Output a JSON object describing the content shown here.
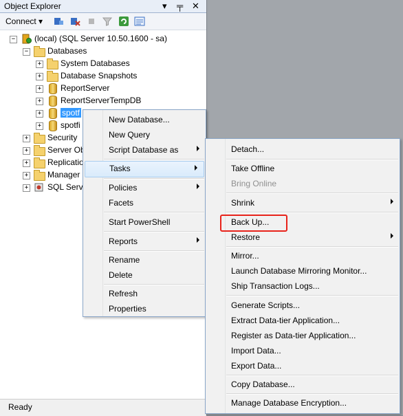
{
  "panel": {
    "title": "Object Explorer",
    "pin_glyph": "▾",
    "pushpin_glyph": "╤",
    "close_glyph": "✕",
    "connect_label": "Connect ▾"
  },
  "tree": [
    {
      "label": "(local) (SQL Server 10.50.1600 - sa)",
      "expander": "−",
      "icon": "server-icon"
    },
    {
      "label": "Databases",
      "expander": "−",
      "icon": "folder-icon"
    },
    {
      "label": "System Databases",
      "expander": "+",
      "icon": "folder-icon"
    },
    {
      "label": "Database Snapshots",
      "expander": "+",
      "icon": "folder-icon"
    },
    {
      "label": "ReportServer",
      "expander": "+",
      "icon": "database-icon"
    },
    {
      "label": "ReportServerTempDB",
      "expander": "+",
      "icon": "database-icon"
    },
    {
      "label": "spotf",
      "expander": "+",
      "icon": "database-icon"
    },
    {
      "label": "spotfi",
      "expander": "+",
      "icon": "database-icon"
    },
    {
      "label": "Security",
      "expander": "+",
      "icon": "folder-icon"
    },
    {
      "label": "Server Ob",
      "expander": "+",
      "icon": "folder-icon"
    },
    {
      "label": "Replicatio",
      "expander": "+",
      "icon": "folder-icon"
    },
    {
      "label": "Manager",
      "expander": "+",
      "icon": "folder-icon"
    },
    {
      "label": "SQL Serve",
      "expander": "+",
      "icon": "agent-icon"
    }
  ],
  "context_menu": [
    {
      "label": "New Database..."
    },
    {
      "label": "New Query"
    },
    {
      "label": "Script Database as",
      "submenu": true
    },
    {
      "label": "Tasks",
      "submenu": true,
      "highlighted": true
    },
    {
      "label": "Policies",
      "submenu": true
    },
    {
      "label": "Facets"
    },
    {
      "label": "Start PowerShell"
    },
    {
      "label": "Reports",
      "submenu": true
    },
    {
      "label": "Rename"
    },
    {
      "label": "Delete"
    },
    {
      "label": "Refresh"
    },
    {
      "label": "Properties"
    }
  ],
  "tasks_menu": [
    {
      "label": "Detach..."
    },
    {
      "label": "Take Offline"
    },
    {
      "label": "Bring Online",
      "disabled": true
    },
    {
      "label": "Shrink",
      "submenu": true
    },
    {
      "label": "Back Up...",
      "callout": true
    },
    {
      "label": "Restore",
      "submenu": true
    },
    {
      "label": "Mirror..."
    },
    {
      "label": "Launch Database Mirroring Monitor..."
    },
    {
      "label": "Ship Transaction Logs..."
    },
    {
      "label": "Generate Scripts..."
    },
    {
      "label": "Extract Data-tier Application..."
    },
    {
      "label": "Register as Data-tier Application..."
    },
    {
      "label": "Import Data..."
    },
    {
      "label": "Export Data..."
    },
    {
      "label": "Copy Database..."
    },
    {
      "label": "Manage Database Encryption..."
    }
  ],
  "status": {
    "text": "Ready"
  },
  "colors": {
    "highlight": "#3399ff",
    "callout": "#e8221a"
  }
}
